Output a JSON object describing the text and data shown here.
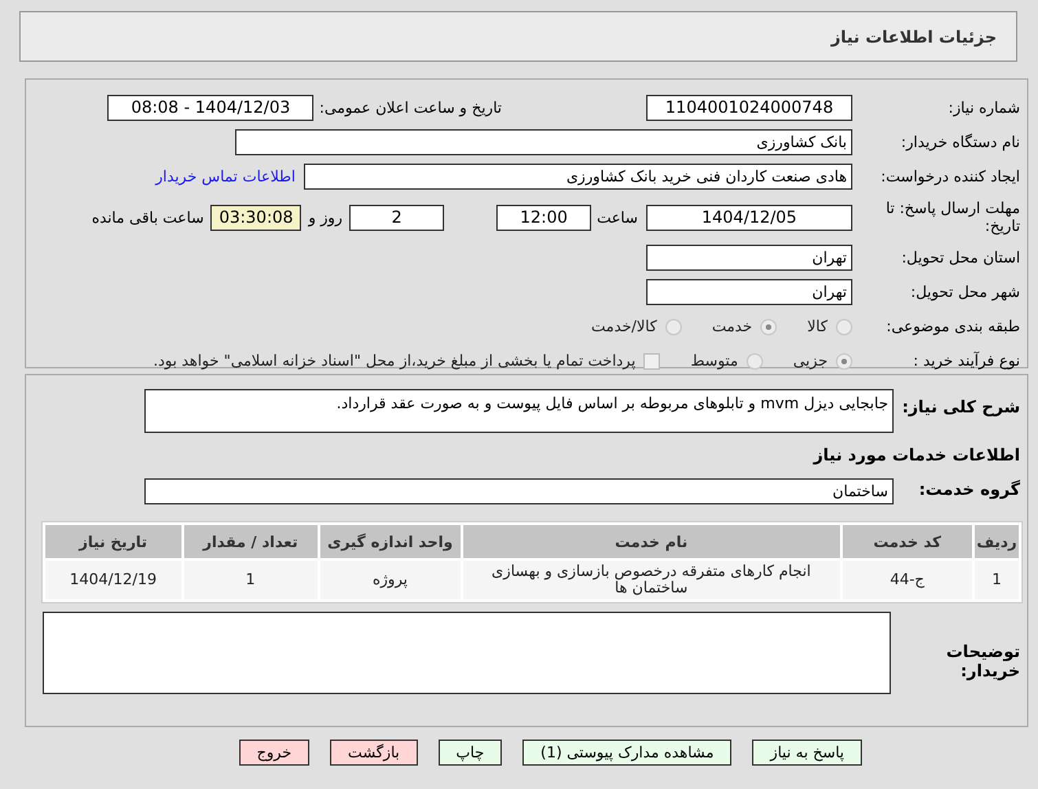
{
  "page_title": "جزئیات اطلاعات نیاز",
  "need_number": {
    "label": "شماره نیاز:",
    "value": "1104001024000748"
  },
  "announce": {
    "label": "تاریخ و ساعت اعلان عمومی:",
    "value": "1404/12/03 - 08:08"
  },
  "buyer": {
    "label": "نام دستگاه خریدار:",
    "value": "بانک کشاورزی"
  },
  "creator": {
    "label": "ایجاد کننده درخواست:",
    "value": "هادی صنعت کاردان فنی خرید بانک کشاورزی",
    "link": "اطلاعات تماس خریدار"
  },
  "deadline": {
    "label": "مهلت ارسال پاسخ: تا تاریخ:",
    "date": "1404/12/05",
    "time_label": "ساعت",
    "time": "12:00",
    "days": "2",
    "days_label": "روز و",
    "remaining": "03:30:08",
    "remaining_label": "ساعت باقی مانده"
  },
  "province": {
    "label": "استان محل تحویل:",
    "value": "تهران"
  },
  "city": {
    "label": "شهر محل تحویل:",
    "value": "تهران"
  },
  "category": {
    "label": "طبقه بندی موضوعی:",
    "options": [
      {
        "label": "کالا",
        "selected": false
      },
      {
        "label": "خدمت",
        "selected": true
      },
      {
        "label": "کالا/خدمت",
        "selected": false
      }
    ]
  },
  "process": {
    "label": "نوع فرآیند خرید :",
    "options": [
      {
        "label": "جزیی",
        "selected": true
      },
      {
        "label": "متوسط",
        "selected": false
      }
    ],
    "payment": {
      "label": "پرداخت تمام یا بخشی از مبلغ خرید،از محل \"اسناد خزانه اسلامی\" خواهد بود.",
      "checked": false
    }
  },
  "description": {
    "label": "شرح کلی نیاز:",
    "value": "جابجایی دیزل mvm و تابلوهای مربوطه بر اساس فایل پیوست و به صورت عقد قرارداد."
  },
  "services_title": "اطلاعات خدمات مورد نیاز",
  "service_group": {
    "label": "گروه خدمت:",
    "value": "ساختمان"
  },
  "table": {
    "columns": [
      "ردیف",
      "کد خدمت",
      "نام خدمت",
      "واحد اندازه گیری",
      "تعداد / مقدار",
      "تاریخ نیاز"
    ],
    "rows": [
      [
        "1",
        "ج-44",
        "انجام کارهای متفرقه درخصوص بازسازی و بهسازی ساختمان ها",
        "پروژه",
        "1",
        "1404/12/19"
      ]
    ]
  },
  "buyer_notes": {
    "label": "توضیحات خریدار:"
  },
  "buttons": [
    {
      "label": "پاسخ به نیاز",
      "kind": "action"
    },
    {
      "label": "مشاهده مدارک پیوستی (1)",
      "kind": "action"
    },
    {
      "label": "چاپ",
      "kind": "action"
    },
    {
      "label": "بازگشت",
      "kind": "danger"
    },
    {
      "label": "خروج",
      "kind": "danger"
    }
  ]
}
